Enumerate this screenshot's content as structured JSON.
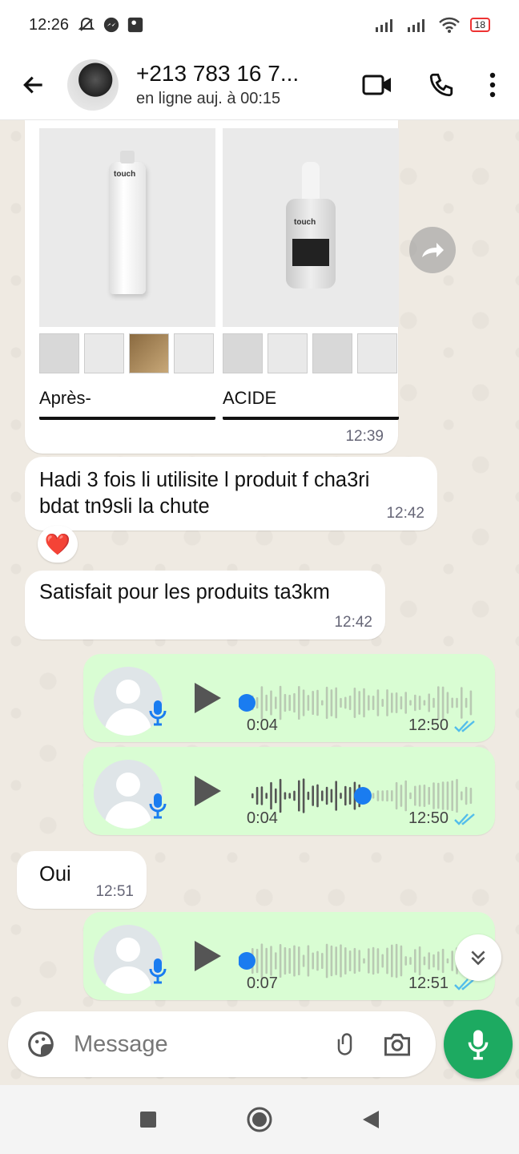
{
  "status": {
    "time": "12:26",
    "battery": "18"
  },
  "contact": {
    "name": "+213 783 16 7...",
    "presence": "en ligne auj. à 00:15"
  },
  "product_card": {
    "products": [
      {
        "title": "Après-",
        "brand": "touch"
      },
      {
        "title": "ACIDE",
        "brand": "touch"
      }
    ],
    "time": "12:39"
  },
  "messages": [
    {
      "text": "Hadi 3 fois li utilisite l produit f cha3ri bdat tn9sli la chute",
      "time": "12:42",
      "reaction": "❤️"
    },
    {
      "text": "Satisfait pour les produits ta3km",
      "time": "12:42"
    },
    {
      "text": "Oui",
      "time": "12:51"
    }
  ],
  "voice_notes": [
    {
      "duration": "0:04",
      "time": "12:50",
      "progress": 0.0
    },
    {
      "duration": "0:04",
      "time": "12:50",
      "progress": 0.5
    },
    {
      "duration": "0:07",
      "time": "12:51",
      "progress": 0.0
    }
  ],
  "composer": {
    "placeholder": "Message"
  },
  "colors": {
    "accent": "#1daa61",
    "outgoing": "#d9fdd3",
    "tick": "#53bdeb",
    "playhead": "#1a7cf0"
  },
  "icons": [
    "back-arrow-icon",
    "video-call-icon",
    "phone-icon",
    "more-vert-icon",
    "forward-icon",
    "sticker-icon",
    "attach-icon",
    "camera-icon",
    "mic-icon",
    "chevron-double-down-icon"
  ]
}
